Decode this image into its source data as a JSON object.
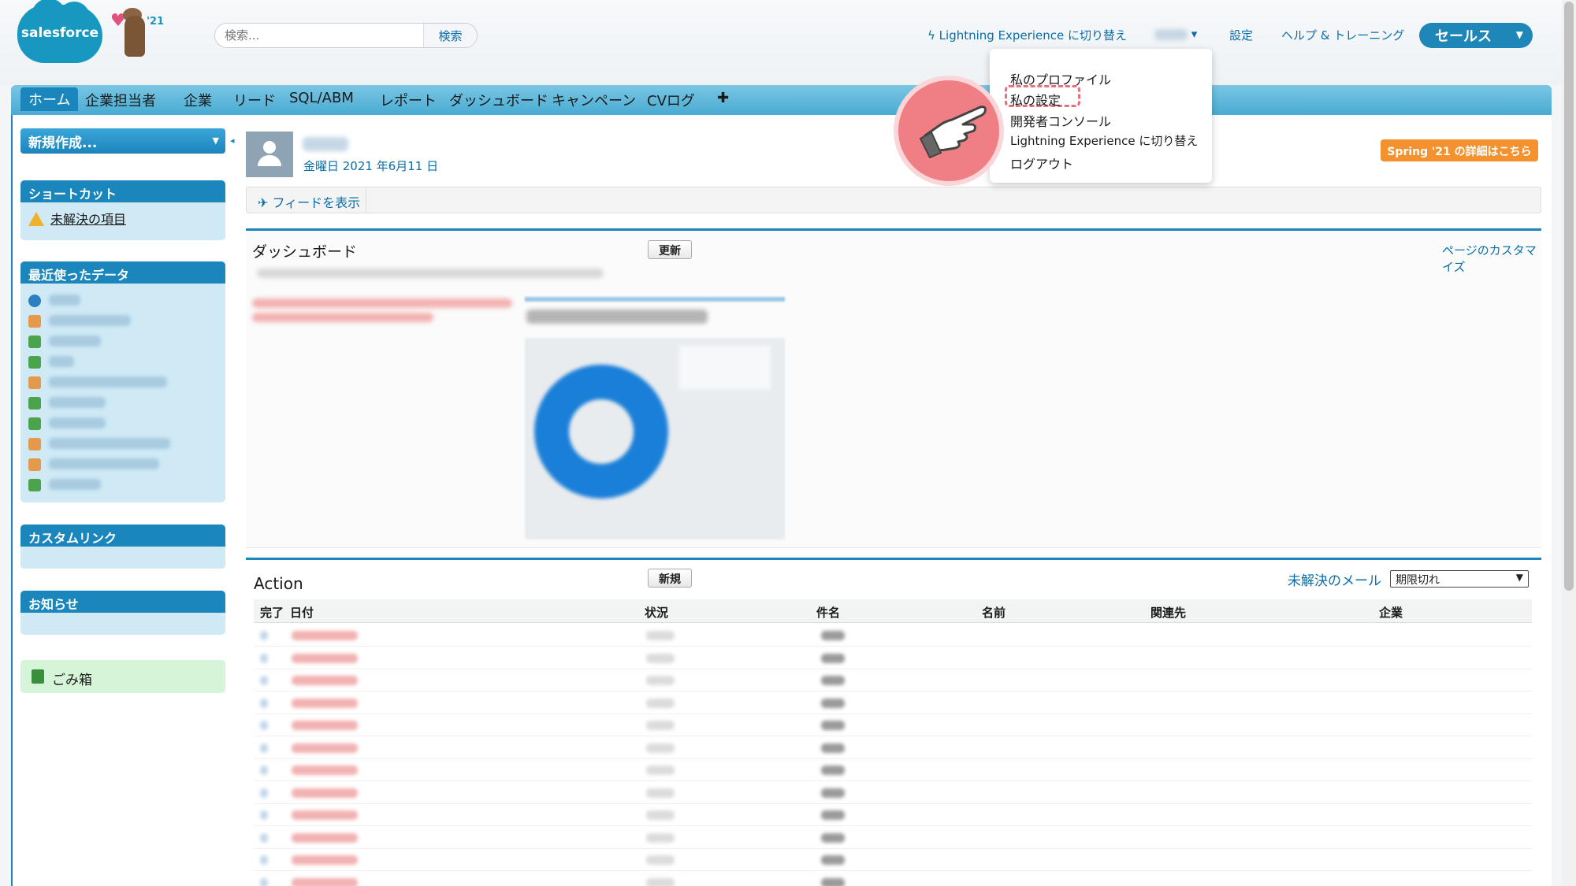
{
  "header": {
    "logo_text": "salesforce",
    "mascot_year": "'21",
    "search": {
      "placeholder": "検索...",
      "button": "検索"
    },
    "lightning_link": "Lightning Experience に切り替え",
    "user_menu_arrow": "▾",
    "setup_link": "設定",
    "help_link": "ヘルプ & トレーニング",
    "app_switcher": "セールス"
  },
  "tabs": [
    {
      "label": "ホーム",
      "active": true
    },
    {
      "label": "企業担当者"
    },
    {
      "label": "企業"
    },
    {
      "label": "リード"
    },
    {
      "label": "SQL/ABM"
    },
    {
      "label": "レポート"
    },
    {
      "label": "ダッシュボード"
    },
    {
      "label": "キャンペーン"
    },
    {
      "label": "CVログ"
    },
    {
      "label": "✚"
    }
  ],
  "sidebar": {
    "new_button": "新規作成...",
    "shortcut": {
      "title": "ショートカット",
      "item": "未解決の項目"
    },
    "recent": {
      "title": "最近使ったデータ"
    },
    "custom_links": {
      "title": "カスタムリンク"
    },
    "notices": {
      "title": "お知らせ"
    },
    "trash": "ごみ箱"
  },
  "user_header": {
    "date": "金曜日 2021 年6月11 日",
    "spring_button": "Spring '21 の詳細はこちら",
    "feed_button": "フィードを表示"
  },
  "dashboard": {
    "title": "ダッシュボード",
    "refresh": "更新",
    "customize": "ページのカスタマイズ"
  },
  "action": {
    "title": "Action",
    "new": "新規",
    "mail_link": "未解決のメール",
    "filter": "期限切れ",
    "columns": [
      "完了",
      "日付",
      "状況",
      "件名",
      "名前",
      "関連先",
      "企業"
    ]
  },
  "user_dropdown": {
    "items": [
      "私のプロファイル",
      "私の設定",
      "開発者コンソール",
      "Lightning Experience に切り替え",
      "ログアウト"
    ],
    "highlighted": "私の設定"
  },
  "colors": {
    "brand": "#1798c1",
    "tab_active": "#1a86bb",
    "accent_orange": "#f3922f",
    "highlight": "#e8707e"
  }
}
